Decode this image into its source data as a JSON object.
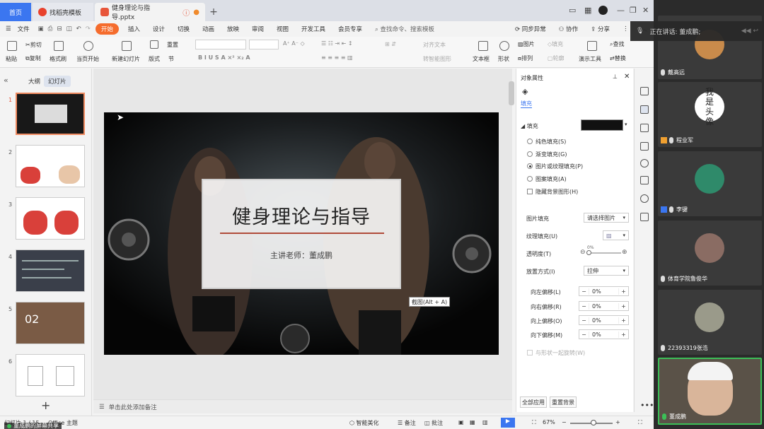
{
  "tabs": [
    {
      "label": "首页"
    },
    {
      "label": "找稻壳模板"
    },
    {
      "label": "健身理论与指导.pptx"
    }
  ],
  "menu": [
    "文件",
    "开始",
    "插入",
    "设计",
    "切换",
    "动画",
    "放映",
    "审阅",
    "视图",
    "开发工具",
    "会员专享"
  ],
  "search_placeholder": "查找命令、搜索模板",
  "menu_right": {
    "sync": "同步异常",
    "collab": "协作",
    "share": "分享"
  },
  "ribbon": {
    "cut": "剪切",
    "copy": "复制",
    "format_painter": "格式刷",
    "paste": "粘贴",
    "from_start": "当页开始",
    "new_slide": "新建幻灯片",
    "layout": "版式",
    "section": "节",
    "reset": "重置",
    "align_text": "对齐文本",
    "smartart": "转智能图形",
    "textbox": "文本框",
    "shape": "形状",
    "arrange": "排列",
    "outline": "轮廓",
    "picture": "图片",
    "fill": "填充",
    "present_tool": "演示工具",
    "find": "查找",
    "replace": "替换"
  },
  "left_panel": {
    "outline_tab": "大纲",
    "slides_tab": "幻灯片",
    "thumb_numbers": [
      "1",
      "2",
      "3",
      "4",
      "5",
      "6"
    ],
    "thumb5_num": "02"
  },
  "slide": {
    "title": "健身理论与指导",
    "subtitle": "主讲老师：董成鹏"
  },
  "tooltip": "截图(Alt + A)",
  "notes_placeholder": "单击此处添加备注",
  "props": {
    "header": "对象属性",
    "tab_fill": "填充",
    "section_fill": "填充",
    "options": [
      "纯色填充(S)",
      "渐变填充(G)",
      "图片或纹理填充(P)",
      "图案填充(A)"
    ],
    "selected_option": 2,
    "hide_bg": "隐藏背景图形(H)",
    "pic_fill_label": "图片填充",
    "pic_fill_value": "请选择图片",
    "texture_label": "纹理填充(U)",
    "transparency_label": "透明度(T)",
    "transparency_value": "0%",
    "transparency_level": 0,
    "placement_label": "放置方式(I)",
    "placement_value": "拉伸",
    "offsets": [
      {
        "label": "向左偏移(L)",
        "value": "0%"
      },
      {
        "label": "向右偏移(R)",
        "value": "0%"
      },
      {
        "label": "向上偏移(O)",
        "value": "0%"
      },
      {
        "label": "向下偏移(M)",
        "value": "0%"
      }
    ],
    "rotate_with_shape": "与形状一起旋转(W)",
    "apply_all": "全部应用",
    "reset_bg": "重置背景"
  },
  "status": {
    "slide_info": "幻灯片 1 / 15",
    "theme": "Office 主题",
    "beautify": "智能美化",
    "notes": "备注",
    "comments": "批注",
    "zoom": "67%",
    "zoom_level": 0.55,
    "share_notice": "董成鹏的屏幕共享"
  },
  "meeting": {
    "speaking": "正在讲话: 董成鹏;",
    "participants": [
      {
        "name": "戴高远",
        "avatar": "dog",
        "host": false
      },
      {
        "name": "程业军",
        "avatar": "text",
        "avatar_text": "我 是 头 像",
        "host": true
      },
      {
        "name": "李键",
        "avatar": "girl",
        "host": true
      },
      {
        "name": "体育学院鲁俊华",
        "avatar": "pair",
        "host": false
      },
      {
        "name": "22393319张浩",
        "avatar": "street",
        "host": false
      },
      {
        "name": "董成鹏",
        "avatar": "video",
        "host": false,
        "active": true
      }
    ]
  },
  "colors": {
    "accent": "#3b76f0",
    "start_tab": "#f56c2d",
    "active_speaker": "#3cbf57"
  }
}
